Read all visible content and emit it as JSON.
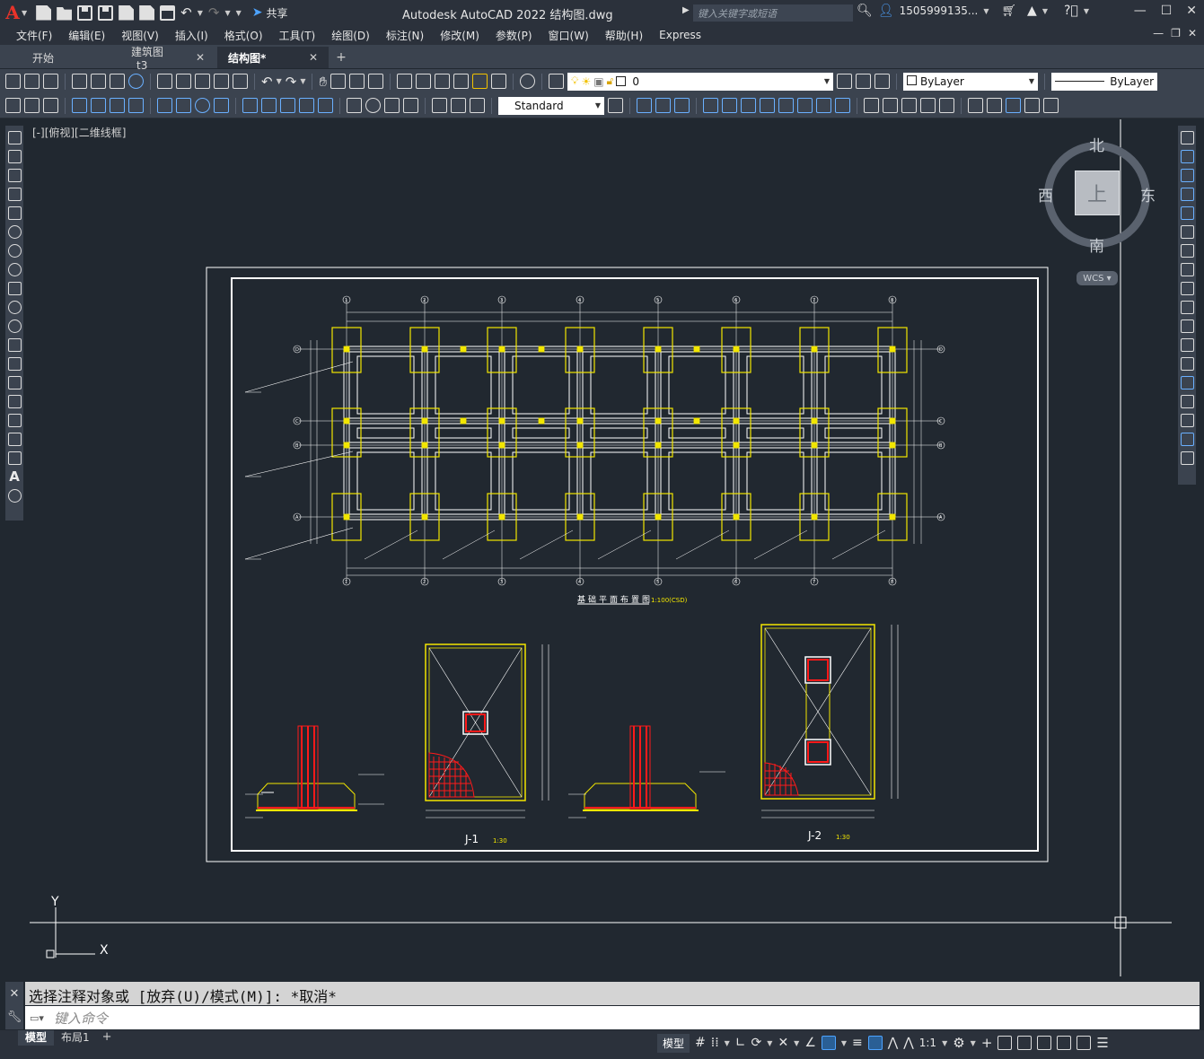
{
  "title_bar": {
    "app_title": "Autodesk AutoCAD 2022    结构图.dwg",
    "share_label": "共享",
    "search_placeholder": "键入关键字或短语",
    "user": "1505999135...",
    "logo": "A"
  },
  "menu": [
    "文件(F)",
    "编辑(E)",
    "视图(V)",
    "插入(I)",
    "格式(O)",
    "工具(T)",
    "绘图(D)",
    "标注(N)",
    "修改(M)",
    "参数(P)",
    "窗口(W)",
    "帮助(H)",
    "Express"
  ],
  "tabs": [
    {
      "label": "开始",
      "closable": false,
      "active": false
    },
    {
      "label": "建筑图_t3",
      "closable": true,
      "active": false
    },
    {
      "label": "结构图*",
      "closable": true,
      "active": true
    }
  ],
  "toolbar": {
    "layer_value": "0",
    "color_value": "ByLayer",
    "linetype_value": "ByLayer",
    "text_style": "Standard"
  },
  "viewport": {
    "label": "[-][俯视][二维线框]"
  },
  "viewcube": {
    "north": "北",
    "south": "南",
    "east": "东",
    "west": "西",
    "face": "上",
    "wcs": "WCS"
  },
  "drawing": {
    "plan_title": "基础平面布置图",
    "plan_scale": "1:100(CSD)",
    "section1_label": "J-1",
    "section1_scale": "1:30",
    "section2_label": "J-2",
    "section2_scale": "1:30",
    "axis_top": [
      "1",
      "2",
      "3",
      "4",
      "5",
      "6",
      "7",
      "8"
    ],
    "axis_side": [
      "D",
      "C",
      "B",
      "A"
    ]
  },
  "ucs": {
    "x": "X",
    "y": "Y"
  },
  "command": {
    "history": "选择注释对象或 [放弃(U)/模式(M)]: *取消*",
    "placeholder": "键入命令"
  },
  "status": {
    "layout_tabs": [
      "模型",
      "布局1"
    ],
    "model_label": "模型",
    "scale": "1:1"
  },
  "colors": {
    "drawing_bg": "#212830",
    "yellow": "#f2e600",
    "red": "#ff1a1a"
  }
}
